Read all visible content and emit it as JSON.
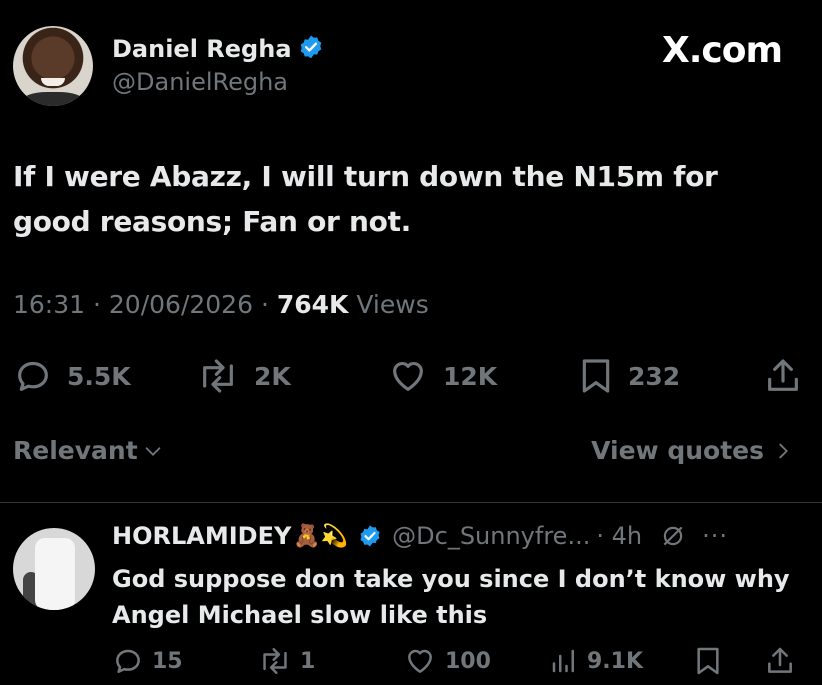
{
  "post": {
    "author_name": "Daniel Regha",
    "author_handle": "@DanielRegha",
    "site_logo": "X.com",
    "text": "If I were Abazz, I will turn down the  N15m for good reasons; Fan or not.",
    "time": "16:31",
    "date": "20/06/2026",
    "views_count": "764K",
    "views_label": "Views",
    "separator": "·",
    "replies": "5.5K",
    "reposts": "2K",
    "likes": "12K",
    "bookmarks": "232"
  },
  "controls": {
    "sort_label": "Relevant",
    "view_quotes_label": "View quotes"
  },
  "reply": {
    "author_name": "HORLAMIDEY",
    "emoji": "🧸💫",
    "handle": "@Dc_Sunnyfre...",
    "time": "· 4h",
    "more": "···",
    "text": "God suppose don take you since I don’t know why Angel Michael slow like this",
    "replies": "15",
    "reposts": "1",
    "likes": "100",
    "views": "9.1K"
  },
  "colors": {
    "background": "#000000",
    "text": "#e7e9ea",
    "muted": "#71767b",
    "verified": "#1d9bf0",
    "divider": "#2f3336"
  },
  "icons": {
    "reply": "speech-bubble",
    "repost": "repost-arrows",
    "like": "heart",
    "bookmark": "bookmark",
    "share": "share-upload",
    "views": "bar-chart",
    "grok": "slashed-circle"
  }
}
